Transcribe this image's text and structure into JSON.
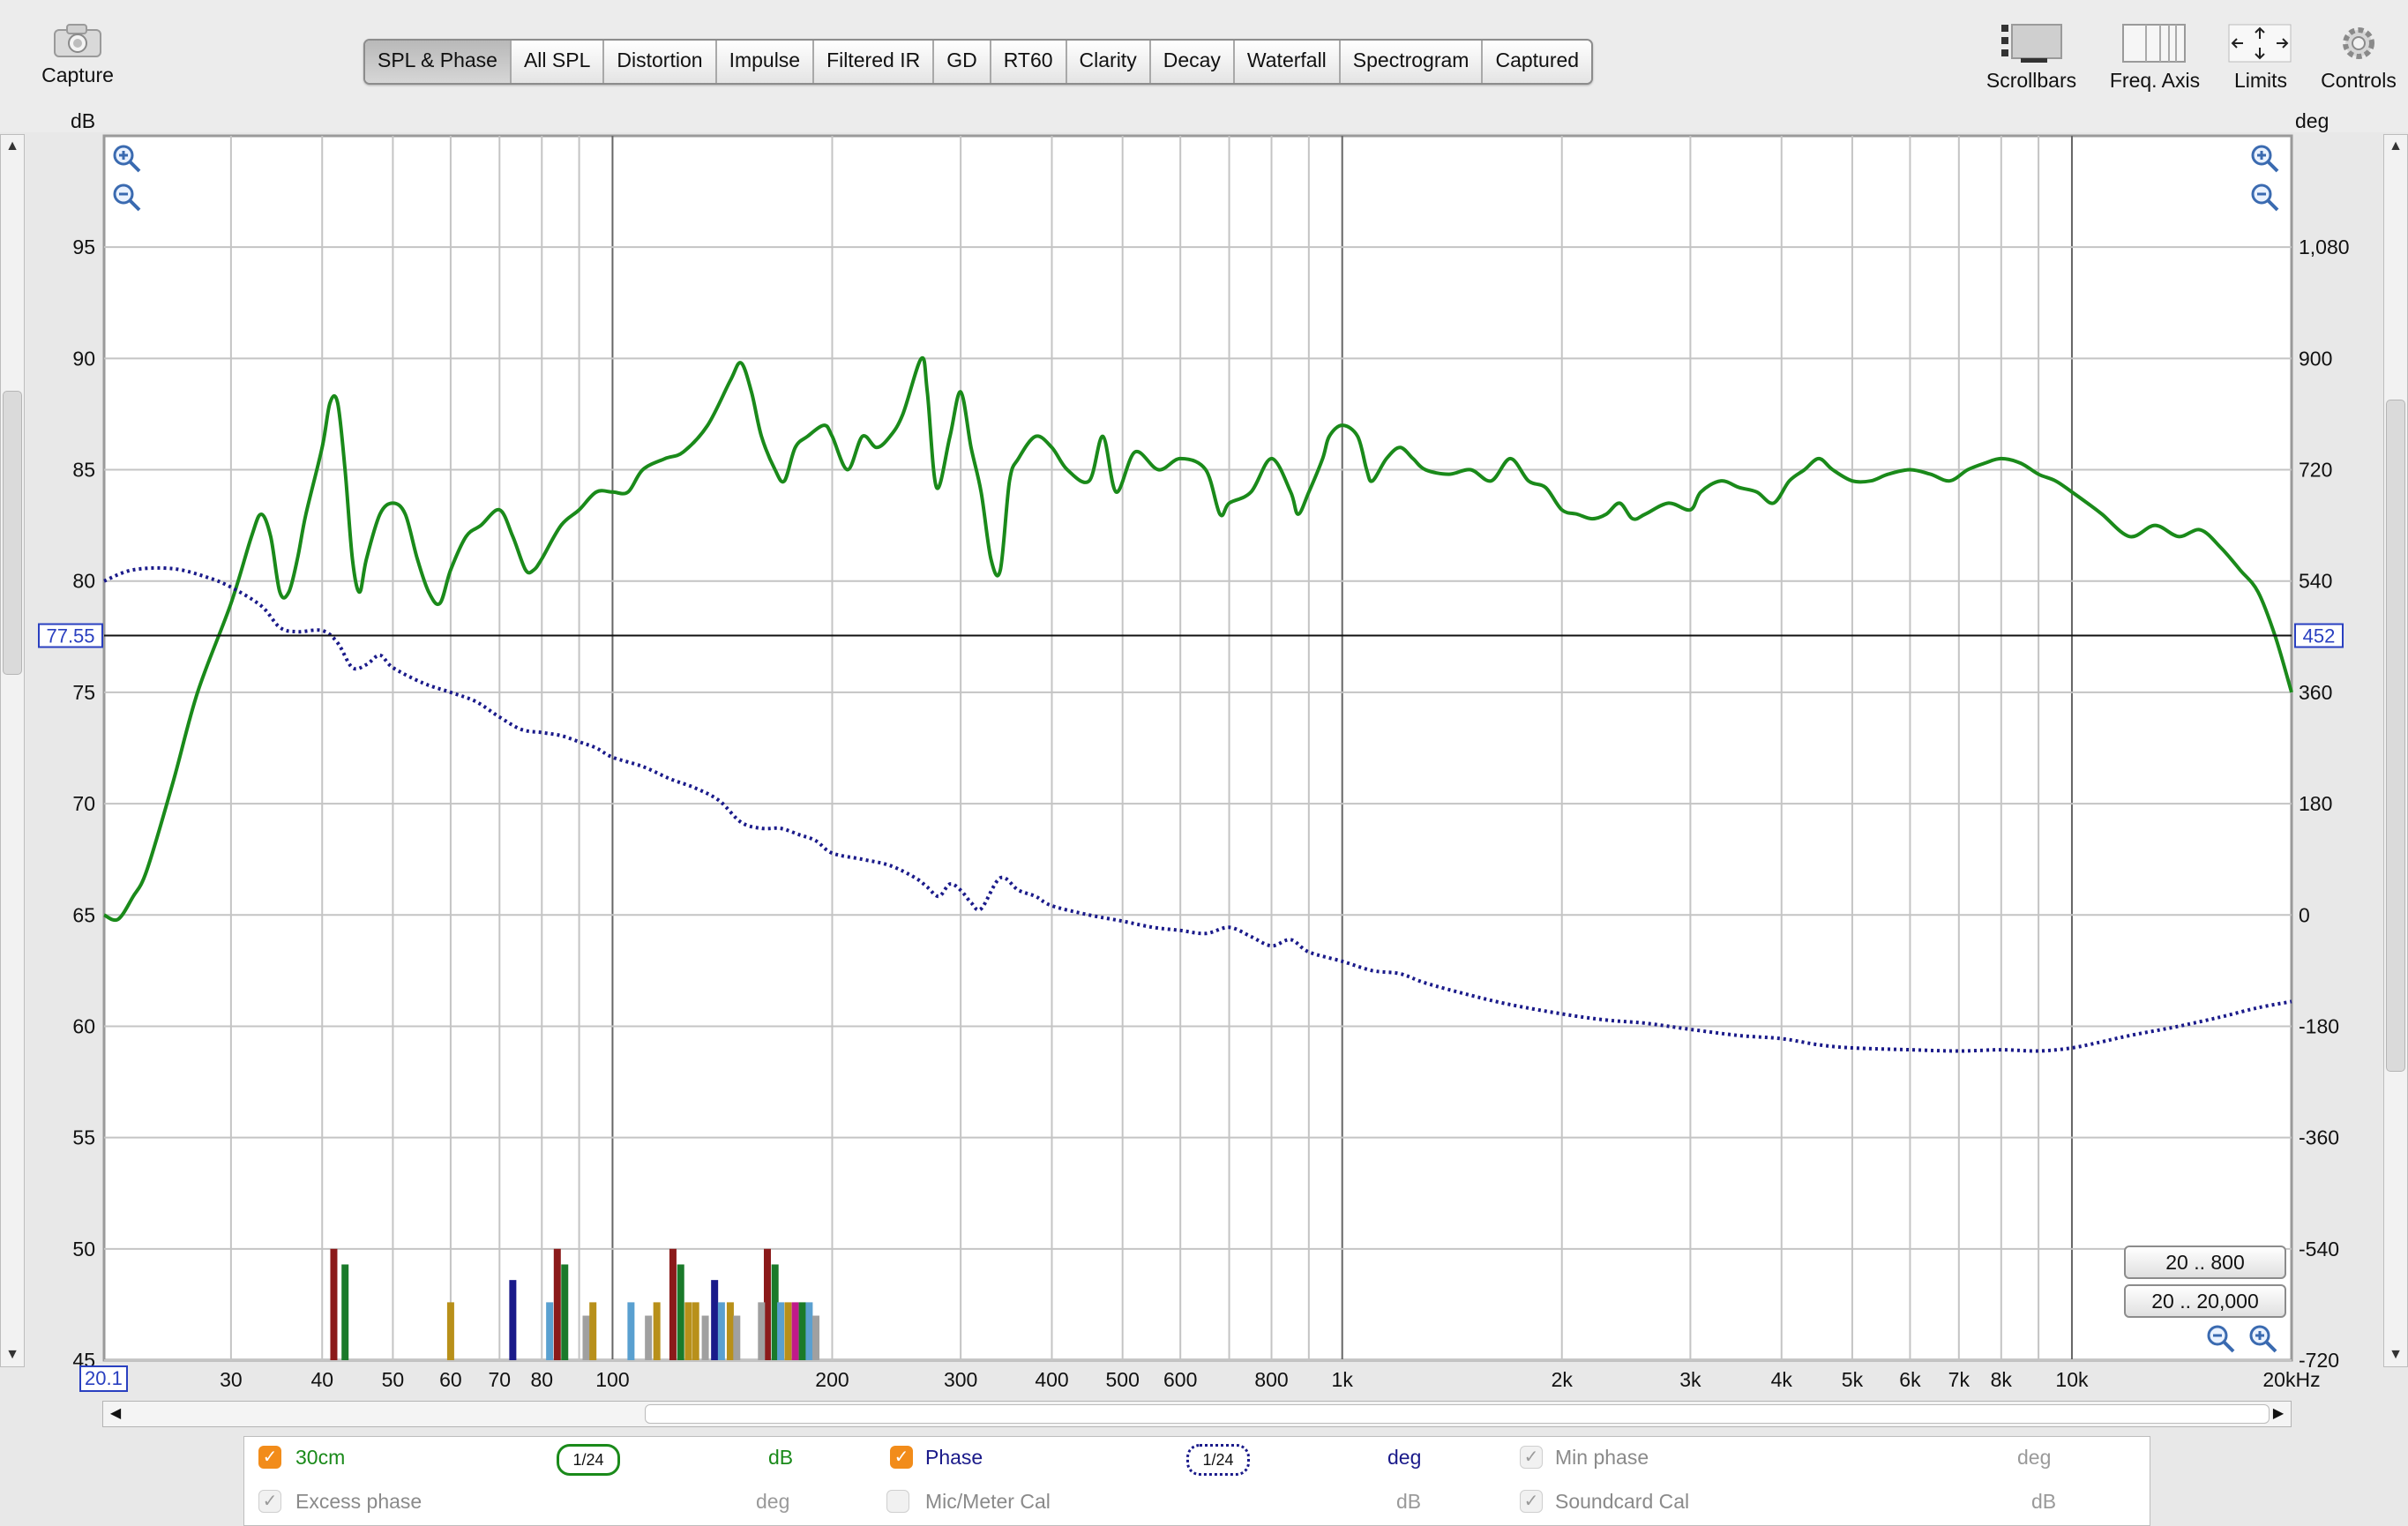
{
  "toolbar": {
    "capture": "Capture",
    "scrollbars": "Scrollbars",
    "freq_axis": "Freq. Axis",
    "limits": "Limits",
    "controls": "Controls"
  },
  "tabs": [
    "SPL & Phase",
    "All SPL",
    "Distortion",
    "Impulse",
    "Filtered IR",
    "GD",
    "RT60",
    "Clarity",
    "Decay",
    "Waterfall",
    "Spectrogram",
    "Captured"
  ],
  "active_tab": "SPL & Phase",
  "axes": {
    "left_unit": "dB",
    "right_unit": "deg",
    "x_start_label": "20.1",
    "cursor_left": "77.55",
    "cursor_right": "452"
  },
  "range_buttons": [
    "20 .. 800",
    "20 .. 20,000"
  ],
  "legend": {
    "spl_name": "30cm",
    "spl_smoothing": "1/24",
    "spl_unit": "dB",
    "phase_name": "Phase",
    "phase_smoothing": "1/24",
    "phase_unit": "deg",
    "minphase_name": "Min phase",
    "minphase_unit": "deg",
    "excess_name": "Excess phase",
    "excess_unit": "deg",
    "mic_name": "Mic/Meter Cal",
    "mic_unit": "dB",
    "sc_name": "Soundcard Cal",
    "sc_unit": "dB"
  },
  "chart_data": {
    "type": "line",
    "x_scale": "log",
    "xlim": [
      20.1,
      20000
    ],
    "ylim": [
      45,
      100
    ],
    "y2lim": [
      -720,
      1260
    ],
    "grid": true,
    "x_ticks": [
      {
        "v": 30,
        "label": "30"
      },
      {
        "v": 40,
        "label": "40"
      },
      {
        "v": 50,
        "label": "50"
      },
      {
        "v": 60,
        "label": "60"
      },
      {
        "v": 70,
        "label": "70"
      },
      {
        "v": 80,
        "label": "80"
      },
      {
        "v": 100,
        "label": "100"
      },
      {
        "v": 200,
        "label": "200"
      },
      {
        "v": 300,
        "label": "300"
      },
      {
        "v": 400,
        "label": "400"
      },
      {
        "v": 500,
        "label": "500"
      },
      {
        "v": 600,
        "label": "600"
      },
      {
        "v": 800,
        "label": "800"
      },
      {
        "v": 1000,
        "label": "1k"
      },
      {
        "v": 2000,
        "label": "2k"
      },
      {
        "v": 3000,
        "label": "3k"
      },
      {
        "v": 4000,
        "label": "4k"
      },
      {
        "v": 5000,
        "label": "5k"
      },
      {
        "v": 6000,
        "label": "6k"
      },
      {
        "v": 7000,
        "label": "7k"
      },
      {
        "v": 8000,
        "label": "8k"
      },
      {
        "v": 10000,
        "label": "10k"
      },
      {
        "v": 20000,
        "label": "20kHz"
      }
    ],
    "y_ticks": [
      {
        "v": 95,
        "label": "95"
      },
      {
        "v": 90,
        "label": "90"
      },
      {
        "v": 85,
        "label": "85"
      },
      {
        "v": 80,
        "label": "80"
      },
      {
        "v": 75,
        "label": "75"
      },
      {
        "v": 70,
        "label": "70"
      },
      {
        "v": 65,
        "label": "65"
      },
      {
        "v": 60,
        "label": "60"
      },
      {
        "v": 55,
        "label": "55"
      },
      {
        "v": 50,
        "label": "50"
      },
      {
        "v": 45,
        "label": "45"
      }
    ],
    "y2_ticks": [
      {
        "v": 1080,
        "label": "1,080"
      },
      {
        "v": 900,
        "label": "900"
      },
      {
        "v": 720,
        "label": "720"
      },
      {
        "v": 540,
        "label": "540"
      },
      {
        "v": 360,
        "label": "360"
      },
      {
        "v": 180,
        "label": "180"
      },
      {
        "v": 0,
        "label": "0"
      },
      {
        "v": -180,
        "label": "-180"
      },
      {
        "v": -360,
        "label": "-360"
      },
      {
        "v": -540,
        "label": "-540"
      },
      {
        "v": -720,
        "label": "-720"
      }
    ],
    "cursor_y": 77.55,
    "series": [
      {
        "name": "30cm",
        "axis": "left",
        "color": "#1a8a1a",
        "points": [
          [
            20.1,
            65
          ],
          [
            21,
            64.8
          ],
          [
            22,
            65.8
          ],
          [
            23,
            67
          ],
          [
            25,
            71
          ],
          [
            27,
            75
          ],
          [
            30,
            79
          ],
          [
            32,
            82
          ],
          [
            33,
            83
          ],
          [
            34,
            82
          ],
          [
            35,
            79.5
          ],
          [
            36,
            79.5
          ],
          [
            37,
            81
          ],
          [
            38,
            83
          ],
          [
            40,
            86
          ],
          [
            41,
            88
          ],
          [
            42,
            88
          ],
          [
            43,
            85
          ],
          [
            44,
            81
          ],
          [
            45,
            79.5
          ],
          [
            46,
            81
          ],
          [
            48,
            83
          ],
          [
            50,
            83.5
          ],
          [
            52,
            83
          ],
          [
            54,
            81
          ],
          [
            56,
            79.5
          ],
          [
            58,
            79
          ],
          [
            60,
            80.5
          ],
          [
            63,
            82
          ],
          [
            66,
            82.5
          ],
          [
            70,
            83.2
          ],
          [
            73,
            82
          ],
          [
            76,
            80.5
          ],
          [
            78,
            80.5
          ],
          [
            80,
            81
          ],
          [
            85,
            82.5
          ],
          [
            90,
            83.2
          ],
          [
            95,
            84
          ],
          [
            100,
            84
          ],
          [
            105,
            84
          ],
          [
            110,
            85
          ],
          [
            118,
            85.5
          ],
          [
            125,
            85.8
          ],
          [
            135,
            87
          ],
          [
            145,
            89
          ],
          [
            150,
            89.8
          ],
          [
            155,
            88.5
          ],
          [
            160,
            86.5
          ],
          [
            167,
            85
          ],
          [
            172,
            84.5
          ],
          [
            178,
            86
          ],
          [
            185,
            86.5
          ],
          [
            195,
            87
          ],
          [
            200,
            86.5
          ],
          [
            210,
            85
          ],
          [
            220,
            86.5
          ],
          [
            230,
            86
          ],
          [
            240,
            86.5
          ],
          [
            250,
            87.5
          ],
          [
            265,
            90
          ],
          [
            270,
            88.5
          ],
          [
            278,
            84.2
          ],
          [
            290,
            86.5
          ],
          [
            300,
            88.5
          ],
          [
            310,
            86
          ],
          [
            320,
            84
          ],
          [
            330,
            81
          ],
          [
            340,
            80.5
          ],
          [
            350,
            84.5
          ],
          [
            360,
            85.5
          ],
          [
            380,
            86.5
          ],
          [
            400,
            86
          ],
          [
            420,
            85
          ],
          [
            450,
            84.5
          ],
          [
            470,
            86.5
          ],
          [
            490,
            84
          ],
          [
            520,
            85.8
          ],
          [
            560,
            85
          ],
          [
            600,
            85.5
          ],
          [
            650,
            85
          ],
          [
            680,
            83
          ],
          [
            700,
            83.5
          ],
          [
            750,
            84
          ],
          [
            800,
            85.5
          ],
          [
            850,
            84
          ],
          [
            870,
            83
          ],
          [
            900,
            84
          ],
          [
            940,
            85.5
          ],
          [
            960,
            86.5
          ],
          [
            1000,
            87
          ],
          [
            1050,
            86.5
          ],
          [
            1080,
            85
          ],
          [
            1100,
            84.5
          ],
          [
            1150,
            85.5
          ],
          [
            1200,
            86
          ],
          [
            1250,
            85.5
          ],
          [
            1300,
            85
          ],
          [
            1400,
            84.8
          ],
          [
            1500,
            85
          ],
          [
            1600,
            84.5
          ],
          [
            1700,
            85.5
          ],
          [
            1800,
            84.5
          ],
          [
            1900,
            84.2
          ],
          [
            2000,
            83.2
          ],
          [
            2100,
            83
          ],
          [
            2200,
            82.8
          ],
          [
            2300,
            83
          ],
          [
            2400,
            83.5
          ],
          [
            2500,
            82.8
          ],
          [
            2600,
            83
          ],
          [
            2800,
            83.5
          ],
          [
            3000,
            83.2
          ],
          [
            3100,
            84
          ],
          [
            3300,
            84.5
          ],
          [
            3500,
            84.2
          ],
          [
            3700,
            84
          ],
          [
            3900,
            83.5
          ],
          [
            4100,
            84.5
          ],
          [
            4300,
            85
          ],
          [
            4500,
            85.5
          ],
          [
            4700,
            85
          ],
          [
            5000,
            84.5
          ],
          [
            5300,
            84.5
          ],
          [
            5600,
            84.8
          ],
          [
            6000,
            85
          ],
          [
            6400,
            84.8
          ],
          [
            6800,
            84.5
          ],
          [
            7200,
            85
          ],
          [
            7600,
            85.3
          ],
          [
            8000,
            85.5
          ],
          [
            8500,
            85.3
          ],
          [
            9000,
            84.8
          ],
          [
            9500,
            84.5
          ],
          [
            10000,
            84
          ],
          [
            10500,
            83.5
          ],
          [
            11000,
            83
          ],
          [
            12000,
            82
          ],
          [
            13000,
            82.5
          ],
          [
            14000,
            82
          ],
          [
            15000,
            82.3
          ],
          [
            16000,
            81.5
          ],
          [
            17000,
            80.5
          ],
          [
            18000,
            79.5
          ],
          [
            19000,
            77.5
          ],
          [
            20000,
            75
          ]
        ]
      },
      {
        "name": "Phase",
        "axis": "right",
        "color": "#1a1a8a",
        "style": "dotted",
        "points": [
          [
            20.1,
            540
          ],
          [
            22,
            558
          ],
          [
            25,
            560
          ],
          [
            28,
            545
          ],
          [
            30,
            530
          ],
          [
            33,
            500
          ],
          [
            35,
            465
          ],
          [
            37,
            458
          ],
          [
            40,
            460
          ],
          [
            42,
            440
          ],
          [
            44,
            400
          ],
          [
            46,
            405
          ],
          [
            48,
            420
          ],
          [
            50,
            400
          ],
          [
            55,
            375
          ],
          [
            60,
            360
          ],
          [
            65,
            345
          ],
          [
            70,
            320
          ],
          [
            75,
            300
          ],
          [
            80,
            295
          ],
          [
            85,
            290
          ],
          [
            90,
            280
          ],
          [
            95,
            270
          ],
          [
            100,
            255
          ],
          [
            110,
            240
          ],
          [
            120,
            220
          ],
          [
            130,
            205
          ],
          [
            140,
            185
          ],
          [
            150,
            150
          ],
          [
            160,
            140
          ],
          [
            170,
            140
          ],
          [
            180,
            130
          ],
          [
            190,
            120
          ],
          [
            200,
            100
          ],
          [
            220,
            90
          ],
          [
            240,
            80
          ],
          [
            260,
            60
          ],
          [
            270,
            45
          ],
          [
            280,
            30
          ],
          [
            290,
            50
          ],
          [
            300,
            40
          ],
          [
            310,
            20
          ],
          [
            320,
            10
          ],
          [
            340,
            60
          ],
          [
            360,
            40
          ],
          [
            380,
            30
          ],
          [
            400,
            15
          ],
          [
            450,
            0
          ],
          [
            500,
            -10
          ],
          [
            550,
            -20
          ],
          [
            600,
            -25
          ],
          [
            650,
            -30
          ],
          [
            700,
            -20
          ],
          [
            750,
            -35
          ],
          [
            800,
            -50
          ],
          [
            850,
            -40
          ],
          [
            900,
            -60
          ],
          [
            1000,
            -75
          ],
          [
            1100,
            -90
          ],
          [
            1200,
            -95
          ],
          [
            1300,
            -110
          ],
          [
            1500,
            -130
          ],
          [
            1700,
            -145
          ],
          [
            2000,
            -160
          ],
          [
            2300,
            -170
          ],
          [
            2600,
            -175
          ],
          [
            3000,
            -185
          ],
          [
            3500,
            -195
          ],
          [
            4000,
            -200
          ],
          [
            4500,
            -210
          ],
          [
            5000,
            -215
          ],
          [
            6000,
            -218
          ],
          [
            7000,
            -220
          ],
          [
            8000,
            -218
          ],
          [
            9000,
            -220
          ],
          [
            10000,
            -215
          ],
          [
            11000,
            -205
          ],
          [
            12000,
            -195
          ],
          [
            14000,
            -180
          ],
          [
            16000,
            -165
          ],
          [
            18000,
            -150
          ],
          [
            20000,
            -140
          ]
        ]
      }
    ],
    "bars": [
      {
        "x": 41.5,
        "db": 50,
        "color": "#8b1a1a"
      },
      {
        "x": 43,
        "db": 49.3,
        "color": "#1a7a2a"
      },
      {
        "x": 60,
        "db": 47.6,
        "color": "#b8901a"
      },
      {
        "x": 73,
        "db": 48.6,
        "color": "#1a1a8a"
      },
      {
        "x": 82,
        "db": 47.6,
        "color": "#5aa0d0"
      },
      {
        "x": 84,
        "db": 50,
        "color": "#8b1a1a"
      },
      {
        "x": 86,
        "db": 49.3,
        "color": "#1a7a2a"
      },
      {
        "x": 92,
        "db": 47,
        "color": "#a0a0a0"
      },
      {
        "x": 94,
        "db": 47.6,
        "color": "#b8901a"
      },
      {
        "x": 106,
        "db": 47.6,
        "color": "#5aa0d0"
      },
      {
        "x": 112,
        "db": 47,
        "color": "#a0a0a0"
      },
      {
        "x": 115,
        "db": 47.6,
        "color": "#b8901a"
      },
      {
        "x": 121,
        "db": 50,
        "color": "#8b1a1a"
      },
      {
        "x": 124,
        "db": 49.3,
        "color": "#1a7a2a"
      },
      {
        "x": 127,
        "db": 47.6,
        "color": "#b8901a"
      },
      {
        "x": 130,
        "db": 47.6,
        "color": "#b8901a"
      },
      {
        "x": 134,
        "db": 47,
        "color": "#a0a0a0"
      },
      {
        "x": 138,
        "db": 48.6,
        "color": "#1a1a8a"
      },
      {
        "x": 141,
        "db": 47.6,
        "color": "#5aa0d0"
      },
      {
        "x": 145,
        "db": 47.6,
        "color": "#b8901a"
      },
      {
        "x": 148,
        "db": 47,
        "color": "#a0a0a0"
      },
      {
        "x": 163,
        "db": 50,
        "color": "#8b1a1a"
      },
      {
        "x": 167,
        "db": 49.3,
        "color": "#1a7a2a"
      },
      {
        "x": 170,
        "db": 47.6,
        "color": "#5aa0d0"
      },
      {
        "x": 174,
        "db": 47.6,
        "color": "#b8901a"
      },
      {
        "x": 178,
        "db": 47.6,
        "color": "#c01a8a"
      },
      {
        "x": 182,
        "db": 47.6,
        "color": "#1a7a2a"
      },
      {
        "x": 186,
        "db": 47.6,
        "color": "#5aa0d0"
      },
      {
        "x": 190,
        "db": 47,
        "color": "#a0a0a0"
      },
      {
        "x": 160,
        "db": 47.6,
        "color": "#a0a0a0"
      }
    ]
  }
}
